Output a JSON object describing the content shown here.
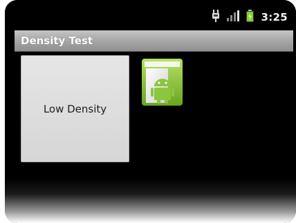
{
  "status_bar": {
    "time": "3:25",
    "icons": [
      "usb-debug-icon",
      "signal-icon",
      "battery-icon"
    ],
    "battery_color": "#7ed321"
  },
  "title_bar": {
    "title": "Density Test"
  },
  "main": {
    "button_label": "Low Density",
    "image_icon": "android-robot-icon"
  },
  "colors": {
    "title_bar": "#a9a9a9",
    "button": "#dcdcdc",
    "background": "#000000",
    "icon_green": "#8cc63f"
  }
}
